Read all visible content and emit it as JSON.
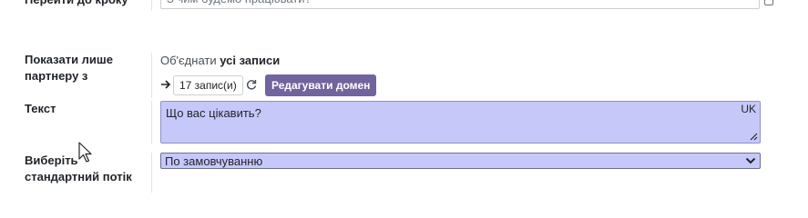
{
  "top_field": {
    "label": "Перейти до кроку",
    "value": "З чим будемо працювати?"
  },
  "partner_filter": {
    "label": "Показати лише партнеру з",
    "domain_prefix": "Об'єднати",
    "domain_bold": "усі записи",
    "record_count": "17 запис(и)",
    "edit_domain_label": "Редагувати домен"
  },
  "text_field": {
    "label": "Текст",
    "value": "Що вас цікавить?",
    "lang": "UK"
  },
  "flow_select": {
    "label": "Виберіть стандартний потік",
    "selected": "По замовчуванню"
  },
  "colors": {
    "accent": "#71639e",
    "field_highlight": "#c7c8fa"
  }
}
